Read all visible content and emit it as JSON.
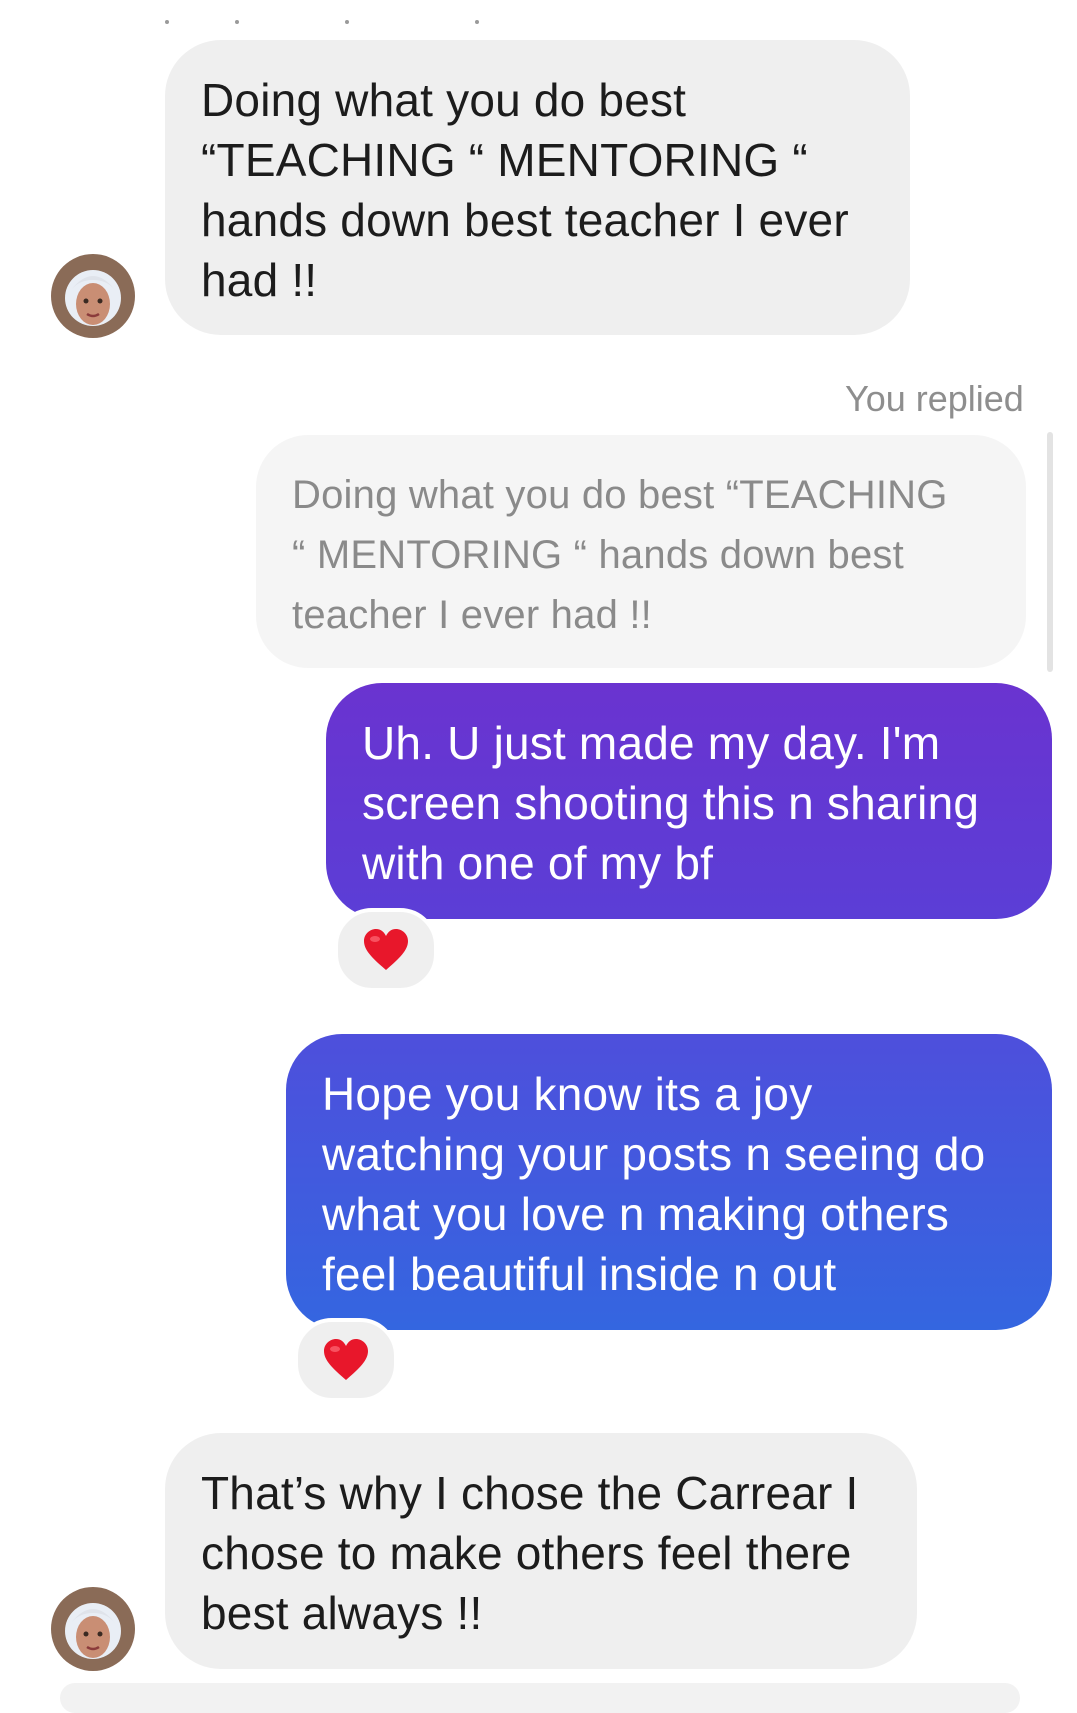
{
  "thread": {
    "messages": [
      {
        "id": "m1",
        "direction": "incoming",
        "lines": [
          "Doing what you do best",
          "“TEACHING “ MENTORING “",
          "hands down best teacher I ever",
          "had !!"
        ]
      },
      {
        "id": "m2",
        "direction": "outgoing",
        "reply_label": "You replied",
        "quoted_lines": [
          "Doing what you do best “TEACHING",
          "“ MENTORING “  hands down best",
          "teacher I ever had !!"
        ],
        "lines": [
          "Uh. U just made my day. I'm",
          "screen shooting this n sharing",
          "with one of my bf"
        ],
        "reaction": "❤️"
      },
      {
        "id": "m3",
        "direction": "outgoing",
        "lines": [
          "Hope you know its a joy",
          "watching your posts n seeing do",
          "what you love n making others",
          "feel beautiful inside n out"
        ],
        "reaction": "❤️"
      },
      {
        "id": "m4",
        "direction": "incoming",
        "lines": [
          "That’s why I chose the Carrear I",
          "chose to make others feel there",
          "best always !!"
        ]
      }
    ]
  },
  "colors": {
    "incoming_bubble": "#efefef",
    "quoted_bubble": "#f5f5f5",
    "outgoing_purple": "#6a33d0",
    "outgoing_indigo": "#4e4fdc",
    "outgoing_blue": "#3466e0",
    "reaction_heart": "#e8172b"
  },
  "icons": {
    "avatar": "contact-avatar-icon",
    "reaction": "red-heart-icon"
  }
}
